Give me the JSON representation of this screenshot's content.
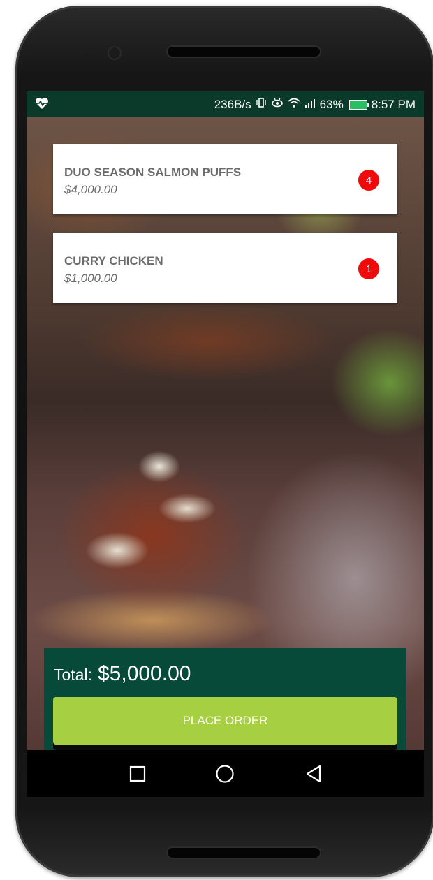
{
  "status_bar": {
    "network_speed": "236B/s",
    "battery_percent": "63%",
    "time": "8:57 PM"
  },
  "order_items": [
    {
      "name": "DUO SEASON SALMON PUFFS",
      "price": "$4,000.00",
      "quantity": "4"
    },
    {
      "name": "CURRY CHICKEN",
      "price": "$1,000.00",
      "quantity": "1"
    }
  ],
  "total": {
    "label": "Total:",
    "value": "$5,000.00"
  },
  "place_order_label": "PLACE ORDER",
  "navbar": {
    "icons": [
      "recents-square-icon",
      "home-circle-icon",
      "back-triangle-icon"
    ]
  },
  "colors": {
    "status_bar_bg": "#0c3a2a",
    "total_panel_bg": "#084a3a",
    "place_order_button": "#a6cf41",
    "quantity_badge": "#ef0b0b"
  }
}
